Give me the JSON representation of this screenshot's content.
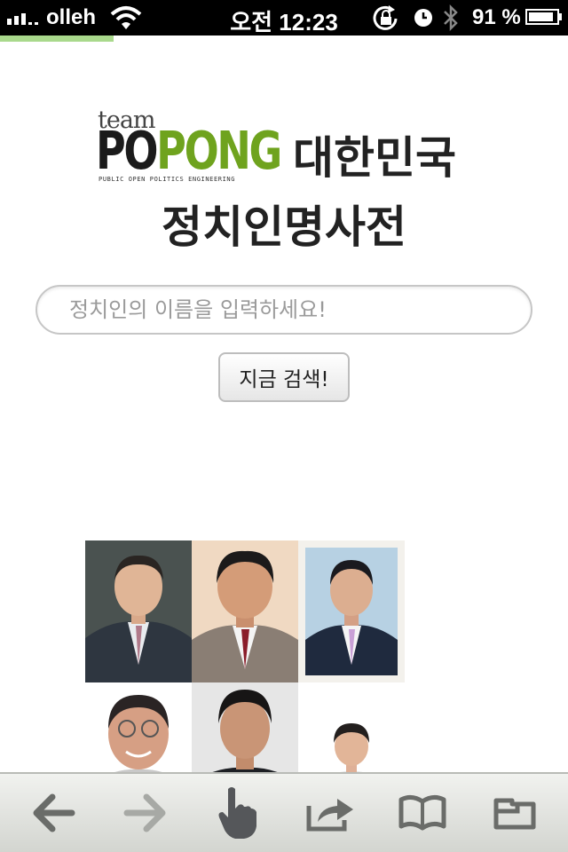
{
  "status_bar": {
    "carrier": "olleh",
    "time": "오전 12:23",
    "battery_percent": "91 %",
    "battery_level": 0.91
  },
  "page_load_progress": 0.2,
  "logo": {
    "team": "team",
    "popong_dark": "PO",
    "popong_green": "PONG",
    "tagline": "PUBLIC OPEN POLITICS ENGINEERING"
  },
  "title": {
    "line1": "대한민국",
    "line2": "정치인명사전"
  },
  "search": {
    "placeholder": "정치인의 이름을 입력하세요!",
    "value": "",
    "button_label": "지금 검색!"
  },
  "photos": [
    {
      "name": "politician-photo-1"
    },
    {
      "name": "politician-photo-2"
    },
    {
      "name": "politician-photo-3"
    },
    {
      "name": "politician-photo-4"
    },
    {
      "name": "politician-photo-5"
    },
    {
      "name": "politician-photo-6"
    }
  ],
  "toolbar": {
    "items": [
      "back-icon",
      "forward-icon",
      "hand-pointer-icon",
      "share-icon",
      "bookmarks-icon",
      "tabs-icon"
    ]
  },
  "colors": {
    "brand_green": "#6fa31e",
    "progress_green": "#a9d98c"
  }
}
